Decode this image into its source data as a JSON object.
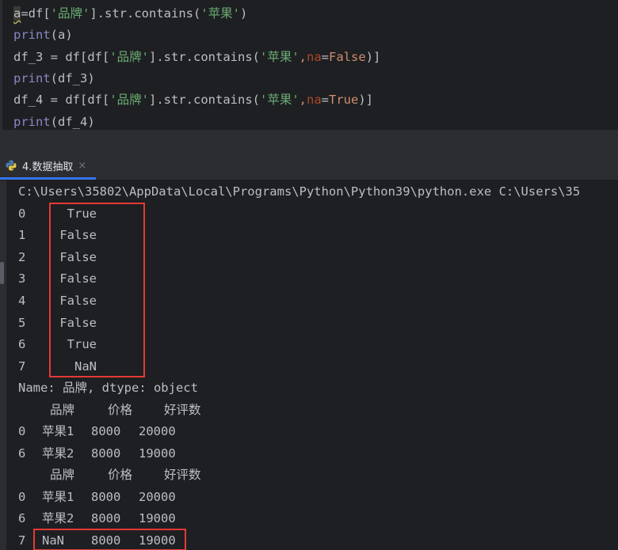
{
  "editor": {
    "lines": [
      [
        {
          "t": "a",
          "c": "cursor"
        },
        {
          "t": "=df[",
          "c": ""
        },
        {
          "t": "'品牌'",
          "c": "str"
        },
        {
          "t": "].str.contains(",
          "c": ""
        },
        {
          "t": "'苹果'",
          "c": "str"
        },
        {
          "t": ")",
          "c": ""
        }
      ],
      [
        {
          "t": "print",
          "c": "fn"
        },
        {
          "t": "(a)",
          "c": ""
        }
      ],
      [
        {
          "t": "df_3 = df[df[",
          "c": ""
        },
        {
          "t": "'品牌'",
          "c": "str"
        },
        {
          "t": "].str.contains(",
          "c": ""
        },
        {
          "t": "'苹果'",
          "c": "str"
        },
        {
          "t": ",",
          "c": "comma"
        },
        {
          "t": "na",
          "c": "param"
        },
        {
          "t": "=",
          "c": ""
        },
        {
          "t": "False",
          "c": "kw"
        },
        {
          "t": ")]",
          "c": ""
        }
      ],
      [
        {
          "t": "print",
          "c": "fn"
        },
        {
          "t": "(df_3)",
          "c": ""
        }
      ],
      [
        {
          "t": "df_4 = df[df[",
          "c": ""
        },
        {
          "t": "'品牌'",
          "c": "str"
        },
        {
          "t": "].str.contains(",
          "c": ""
        },
        {
          "t": "'苹果'",
          "c": "str"
        },
        {
          "t": ",",
          "c": "comma"
        },
        {
          "t": "na",
          "c": "param"
        },
        {
          "t": "=",
          "c": ""
        },
        {
          "t": "True",
          "c": "kw"
        },
        {
          "t": ")]",
          "c": ""
        }
      ],
      [
        {
          "t": "print",
          "c": "fn"
        },
        {
          "t": "(df_4)",
          "c": ""
        }
      ]
    ]
  },
  "run": {
    "tab_label": "4.数据抽取",
    "tab_close": "×",
    "tab_icon": "python-icon"
  },
  "console": {
    "command": "C:\\Users\\35802\\AppData\\Local\\Programs\\Python\\Python39\\python.exe C:\\Users\\35",
    "series": [
      {
        "index": "0",
        "value": "True"
      },
      {
        "index": "1",
        "value": "False"
      },
      {
        "index": "2",
        "value": "False"
      },
      {
        "index": "3",
        "value": "False"
      },
      {
        "index": "4",
        "value": "False"
      },
      {
        "index": "5",
        "value": "False"
      },
      {
        "index": "6",
        "value": "True"
      },
      {
        "index": "7",
        "value": "NaN"
      }
    ],
    "series_footer": "Name: 品牌, dtype: object",
    "df3": {
      "columns": [
        "品牌",
        "价格",
        "好评数"
      ],
      "rows": [
        {
          "index": "0",
          "cells": [
            "苹果1",
            "8000",
            "20000"
          ]
        },
        {
          "index": "6",
          "cells": [
            "苹果2",
            "8000",
            "19000"
          ]
        }
      ]
    },
    "df4": {
      "columns": [
        "品牌",
        "价格",
        "好评数"
      ],
      "rows": [
        {
          "index": "0",
          "cells": [
            "苹果1",
            "8000",
            "20000"
          ]
        },
        {
          "index": "6",
          "cells": [
            "苹果2",
            "8000",
            "19000"
          ]
        },
        {
          "index": "7",
          "cells": [
            "NaN",
            "8000",
            "19000"
          ]
        }
      ]
    }
  },
  "colors": {
    "highlight_box": "#e53935",
    "editor_bg": "#1e1f22",
    "string": "#6aab73",
    "keyword": "#cf8e6d",
    "builtin": "#8888c6"
  }
}
